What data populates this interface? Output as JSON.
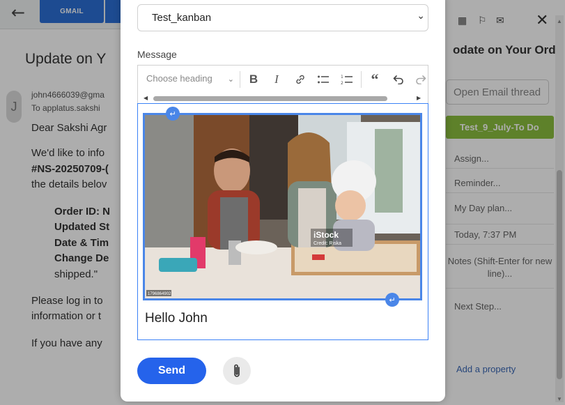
{
  "email": {
    "tab_label": "GMAIL",
    "subject": "Update on Y",
    "avatar_letter": "J",
    "from": "john4666039@gma",
    "to": "To applatus.sakshi",
    "greeting": "Dear Sakshi Agr",
    "para1_line1": "We'd like to info",
    "para1_line2": "#NS-20250709-(",
    "para1_line3": "the details belov",
    "order_id": "Order ID: N",
    "updated_status": "Updated St",
    "date_time": "Date & Tim",
    "change_desc": "Change De",
    "shipped": "shipped.\"",
    "para2_line1": "Please log in to",
    "para2_line2": "information or t",
    "para3_line1": "If you have any"
  },
  "task_panel": {
    "title": "odate on Your Ord",
    "open_email_label": "Open Email thread",
    "status_label": "Test_9_July-To Do",
    "assign": "Assign...",
    "reminder": "Reminder...",
    "my_day": "My Day plan...",
    "date": "Today, 7:37 PM",
    "notes": "Notes (Shift-Enter for new line)...",
    "next_step": "Next Step...",
    "add_property": "Add a property"
  },
  "modal": {
    "board_select": "Test_kanban",
    "message_label": "Message",
    "heading_placeholder": "Choose heading",
    "editor_text": "Hello John",
    "send_label": "Send",
    "image": {
      "watermark": "iStock",
      "watermark_credit": "Credit: Riska",
      "stock_id": "1796864902"
    }
  },
  "colors": {
    "primary": "#2563eb",
    "status_green": "#8bbf3f",
    "selection_blue": "#4a86e8"
  }
}
